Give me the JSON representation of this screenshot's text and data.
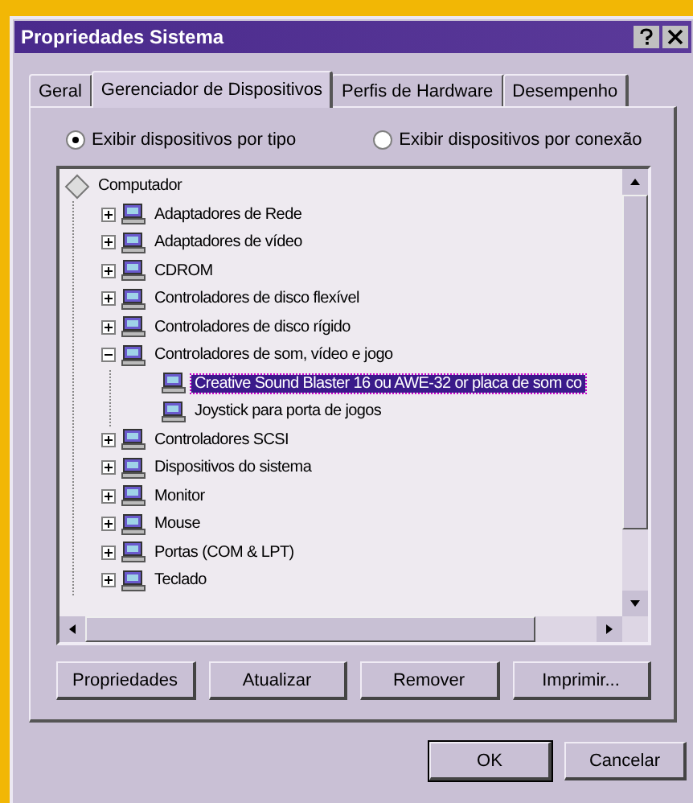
{
  "window": {
    "title": "Propriedades Sistema"
  },
  "tabs": [
    {
      "label": "Geral",
      "selected": false
    },
    {
      "label": "Gerenciador de Dispositivos",
      "selected": true
    },
    {
      "label": "Perfis de Hardware",
      "selected": false
    },
    {
      "label": "Desempenho",
      "selected": false
    }
  ],
  "view_options": [
    {
      "label": "Exibir dispositivos por tipo",
      "selected": true
    },
    {
      "label": "Exibir dispositivos por conexão",
      "selected": false
    }
  ],
  "tree": {
    "label": "Computador",
    "selected": false,
    "children": [
      {
        "label": "Adaptadores de Rede",
        "expanded": false,
        "selected": false
      },
      {
        "label": "Adaptadores de vídeo",
        "expanded": false,
        "selected": false
      },
      {
        "label": "CDROM",
        "expanded": false,
        "selected": false
      },
      {
        "label": "Controladores de disco flexível",
        "expanded": false,
        "selected": false
      },
      {
        "label": "Controladores de disco rígido",
        "expanded": false,
        "selected": false
      },
      {
        "label": "Controladores de som, vídeo e jogo",
        "expanded": true,
        "selected": false,
        "children": [
          {
            "label": "Creative Sound Blaster 16 ou AWE-32 or placa de som co",
            "selected": true
          },
          {
            "label": "Joystick para porta de jogos",
            "selected": false
          }
        ]
      },
      {
        "label": "Controladores SCSI",
        "expanded": false,
        "selected": false
      },
      {
        "label": "Dispositivos do sistema",
        "expanded": false,
        "selected": false
      },
      {
        "label": "Monitor",
        "expanded": false,
        "selected": false
      },
      {
        "label": "Mouse",
        "expanded": false,
        "selected": false
      },
      {
        "label": "Portas (COM & LPT)",
        "expanded": false,
        "selected": false
      },
      {
        "label": "Teclado",
        "expanded": false,
        "selected": false
      }
    ]
  },
  "buttons": [
    "Propriedades",
    "Atualizar",
    "Remover",
    "Imprimir..."
  ],
  "dialog_buttons": [
    "OK",
    "Cancelar"
  ]
}
